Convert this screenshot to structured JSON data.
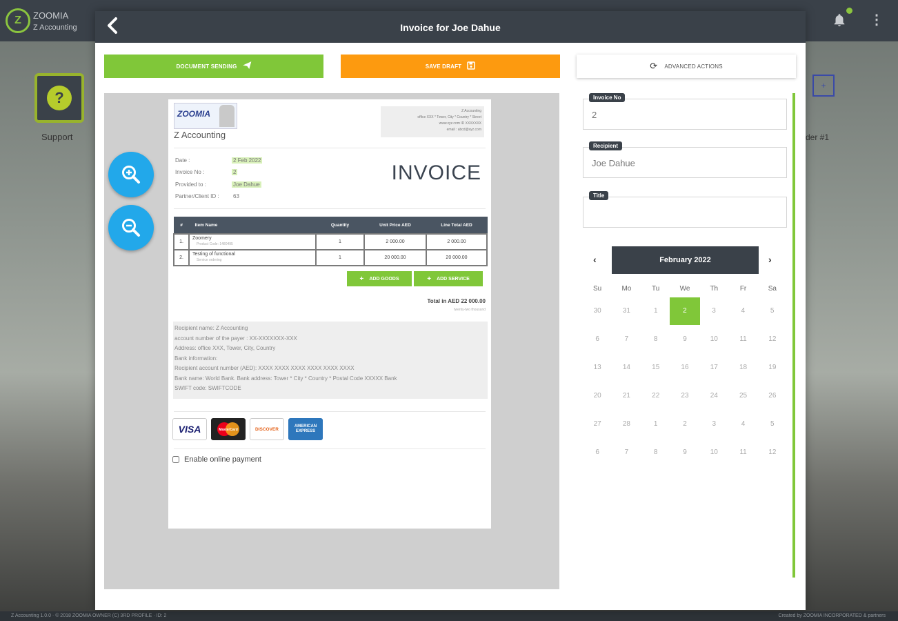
{
  "app": {
    "logo_letter": "Z",
    "name": "ZOOMIA",
    "subtitle": "Z Accounting",
    "support_label": "Support",
    "right_tile_label": "der #1",
    "footer_left": "Z Accounting 1.0.0 · © 2018 ZOOMIA OWNER (C) 3RD PROFILE · ID: 2",
    "footer_right": "Created by ZOOMIA INCORPORATED & partners"
  },
  "modal": {
    "title": "Invoice for Joe Dahue",
    "buttons": {
      "send": "DOCUMENT SENDING",
      "draft": "SAVE DRAFT",
      "advanced": "ADVANCED ACTIONS"
    }
  },
  "invoice": {
    "logo_text": "ZOOMIA",
    "company": "Z Accounting",
    "address_lines": [
      "Z Accounting",
      "office XXX * Tower, City * Country * Street",
      "www.xyz.com ID XXXXXXX",
      "email : abcd@xyz.com"
    ],
    "meta": [
      {
        "label": "Date :",
        "value": "2 Feb 2022"
      },
      {
        "label": "Invoice No :",
        "value": "2"
      },
      {
        "label": "Provided to :",
        "value": "Joe Dahue"
      },
      {
        "label": "Partner/Client ID :",
        "value": "63"
      }
    ],
    "heading": "INVOICE",
    "table": {
      "headers": [
        "#",
        "Item Name",
        "Quantity",
        "Unit Price AED",
        "Line Total AED"
      ],
      "rows": [
        {
          "num": "1.",
          "name": "Zoomery",
          "detail": "Product Code: 1480495",
          "qty": "1",
          "price": "2 000.00",
          "total": "2 000.00"
        },
        {
          "num": "2.",
          "name": "Testing of functional",
          "detail": "Service ordering",
          "qty": "1",
          "price": "20 000.00",
          "total": "20 000.00"
        }
      ]
    },
    "add_goods": "ADD GOODS",
    "add_service": "ADD SERVICE",
    "total": "Total in AED 22 000.00",
    "total_words": "twenty-two thousand",
    "bank_lines": [
      "Recipient name: Z Accounting",
      "account number of the payer : XX-XXXXXXX-XXX",
      "Address: office XXX, Tower, City, Country",
      "Bank information:",
      "Recipient account number (AED): XXXX XXXX XXXX XXXX XXXX XXXX",
      "Bank name: World Bank. Bank address: Tower * City * Country * Postal Code XXXXX Bank",
      "SWIFT code: SWIFTCODE"
    ],
    "cards": {
      "visa": "VISA",
      "mastercard": "MasterCard",
      "discover": "DISCOVER",
      "amex": "AMERICAN EXPRESS"
    },
    "online_payment": "Enable online payment"
  },
  "form": {
    "invoice_no": {
      "label": "Invoice No",
      "value": "2"
    },
    "recipient": {
      "label": "Recipient",
      "value": "Joe Dahue"
    },
    "title": {
      "label": "Title",
      "value": ""
    }
  },
  "calendar": {
    "month": "February 2022",
    "dow": [
      "Su",
      "Mo",
      "Tu",
      "We",
      "Th",
      "Fr",
      "Sa"
    ],
    "weeks": [
      [
        "30",
        "31",
        "1",
        "2",
        "3",
        "4",
        "5"
      ],
      [
        "6",
        "7",
        "8",
        "9",
        "10",
        "11",
        "12"
      ],
      [
        "13",
        "14",
        "15",
        "16",
        "17",
        "18",
        "19"
      ],
      [
        "20",
        "21",
        "22",
        "23",
        "24",
        "25",
        "26"
      ],
      [
        "27",
        "28",
        "1",
        "2",
        "3",
        "4",
        "5"
      ],
      [
        "6",
        "7",
        "8",
        "9",
        "10",
        "11",
        "12"
      ]
    ],
    "selected": "2",
    "accent": "#80c739"
  },
  "colors": {
    "header": "#3a4149",
    "green": "#80c739",
    "orange": "#fd9a0f",
    "zoom": "#22a8ea"
  },
  "icons": {
    "back": "chevron-left-icon",
    "send": "paper-plane-icon",
    "draft": "floppy-disk-icon",
    "advanced": "refresh-icon",
    "bell": "bell-icon",
    "menu": "kebab-menu-icon"
  }
}
